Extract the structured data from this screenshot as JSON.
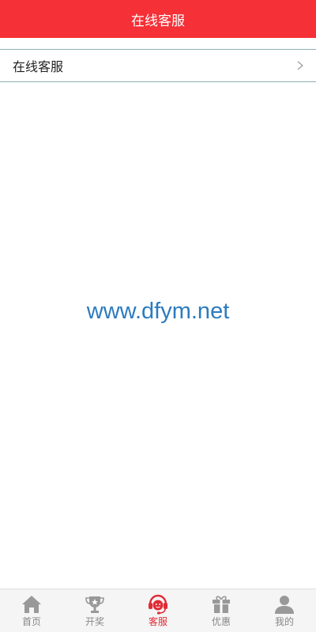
{
  "header": {
    "title": "在线客服"
  },
  "list": {
    "items": [
      {
        "label": "在线客服"
      }
    ]
  },
  "watermark": {
    "text": "www.dfym.net"
  },
  "tabbar": {
    "active_index": 2,
    "tabs": [
      {
        "label": "首页",
        "icon": "home-icon"
      },
      {
        "label": "开奖",
        "icon": "trophy-icon"
      },
      {
        "label": "客服",
        "icon": "headset-icon"
      },
      {
        "label": "优惠",
        "icon": "gift-icon"
      },
      {
        "label": "我的",
        "icon": "user-icon"
      }
    ]
  },
  "colors": {
    "header_bg": "#f53036",
    "active_tab": "#e22b35",
    "inactive_icon": "#999999",
    "watermark": "#2c7bbf"
  }
}
